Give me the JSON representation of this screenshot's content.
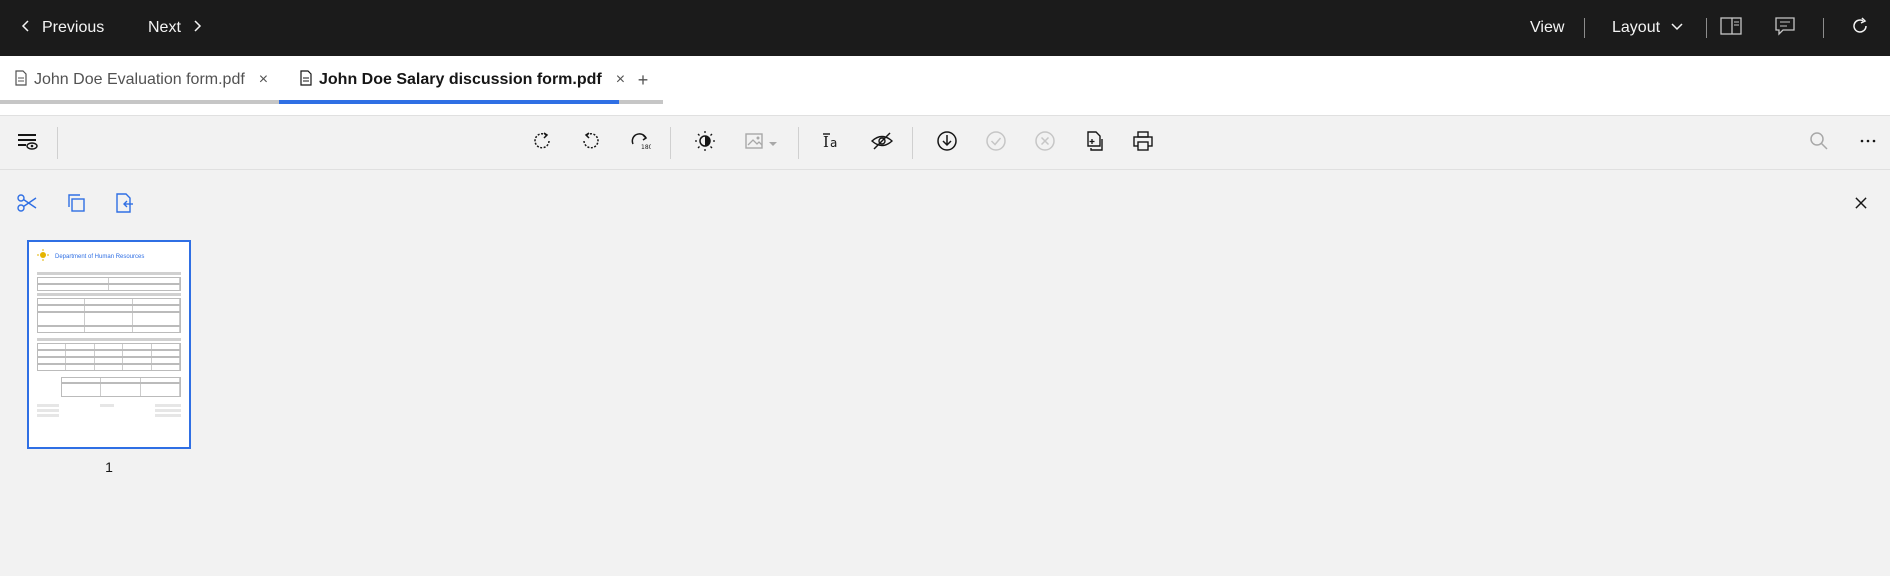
{
  "topbar": {
    "previous_label": "Previous",
    "next_label": "Next",
    "view_label": "View",
    "layout_label": "Layout"
  },
  "tabs": [
    {
      "label": "John Doe Evaluation form.pdf",
      "active": false
    },
    {
      "label": "John Doe Salary discussion form.pdf",
      "active": true
    }
  ],
  "tab_add_label": "+",
  "tab_close_glyph": "×",
  "thumbnails": [
    {
      "page_number": "1",
      "header_title": "Department of Human Resources"
    }
  ],
  "icons": {
    "toolbar": [
      "view-options-icon",
      "rotate-clockwise-icon",
      "rotate-counterclockwise-icon",
      "rotate-180-icon",
      "contrast-icon",
      "image-adjust-icon",
      "text-recognition-icon",
      "hide-annotations-icon",
      "download-icon",
      "accept-icon",
      "reject-icon",
      "copy-pages-icon",
      "print-icon",
      "search-icon",
      "overflow-menu-icon"
    ],
    "page_ops": [
      "cut-icon",
      "copy-icon",
      "paste-page-icon",
      "close-icon"
    ]
  },
  "colors": {
    "topbar_bg": "#1b1b1b",
    "accent": "#2f6fe4",
    "workspace_bg": "#f2f2f2"
  }
}
